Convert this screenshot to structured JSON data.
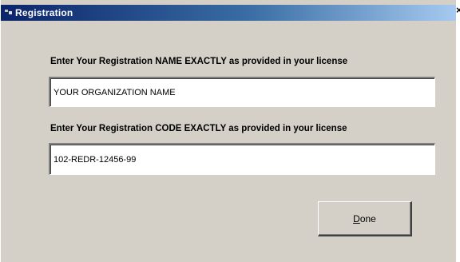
{
  "window": {
    "title": "Registration",
    "close_glyph": "×",
    "icon": "app-icon"
  },
  "form": {
    "name_label": "Enter Your Registration NAME EXACTLY as provided in your license",
    "name_value": "YOUR ORGANIZATION NAME",
    "code_label": "Enter Your Registration CODE EXACTLY as provided in your license",
    "code_value": "102-REDR-12456-99"
  },
  "buttons": {
    "done_accel": "D",
    "done_rest": "one"
  }
}
